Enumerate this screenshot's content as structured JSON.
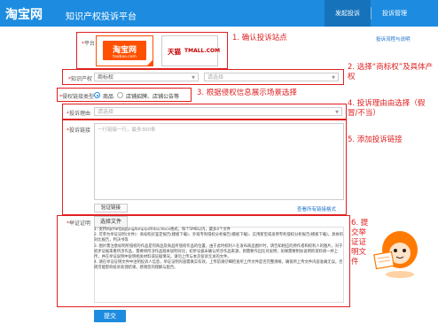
{
  "header": {
    "logo": "淘宝网",
    "platform": "知识产权投诉平台",
    "tabs": [
      {
        "label": "发起投诉",
        "active": true
      },
      {
        "label": "投诉管理",
        "active": false
      }
    ]
  },
  "platform_row": {
    "label": "平台",
    "options": [
      {
        "brand": "淘宝网",
        "sub": "taobao.com",
        "selected": true
      },
      {
        "brand": "天猫",
        "sub": "TMALL.COM",
        "selected": false
      }
    ],
    "help_link": "投诉流程与说明"
  },
  "ip_row": {
    "label": "知识产权",
    "value": "商标权",
    "secondary_placeholder": "请选择"
  },
  "scenario_row": {
    "label": "侵权链接类型",
    "options": [
      {
        "label": "商品",
        "selected": true
      },
      {
        "label": "店铺招牌、店铺公告等",
        "selected": false
      }
    ]
  },
  "reason_row": {
    "label": "投诉理由",
    "placeholder": "请选择"
  },
  "links_row": {
    "label": "投诉链接",
    "placeholder": "一行链接一行，最多300条",
    "button": "验证链接",
    "format_link": "查看所有链接格式"
  },
  "evidence": {
    "label": "举证证明",
    "tab": "选择文件",
    "instructions": [
      "1. 支持zip/rar/jpg/png/bmp/pdf/doc/docx格式，每个5MB以内，最多4个文件",
      "2. 可参为举证证明(文件)：商标购买鉴定报告(模板下载)、外观专利侵权分析报告(模板下载)、实用新型或发明专利侵权分析报告(模板下载)，具体的对比报告，判决书等",
      "3. 图片需注意标明所侵权的作品是何商品及商品所侵权作品的位置，由于此时权利人在发布商品图片时，请告知相应的原作者和权利人的图片，对于初步证据来看所涉作品，需要将所涉作品版本说明对比；初步证据未确认所涉作品来源，则需要作出比对说明；如果需要附加说明的资料请一并上传，并在举证说明中说明相关材料或证据情况。请勿上传与本次投诉无关的文件。",
      "4. 请在举证证明文件中注明投诉人信息，举证证明内容需真实有效，上传前请仔细检查所上传文件是否完整清晰，确保所上传文件内容准确无误，否则可能影响投诉处理结果。感谢您的理解与配合。"
    ],
    "submit": "提交"
  },
  "mascot": {
    "caption": "淘宝网"
  },
  "annotations": [
    "1. 确认投诉站点",
    "2. 选择“商标权”及具体产权",
    "3. 根据侵权信息展示场景选择",
    "4. 投诉理由由选择（假冒/不当）",
    "5. 添加投诉链接",
    "6. 提交举证证明文件"
  ],
  "colors": {
    "header": "#1d8ce0",
    "annotation": "#e02020",
    "taobao_orange": "#ff5000",
    "tmall_red": "#c40000"
  }
}
